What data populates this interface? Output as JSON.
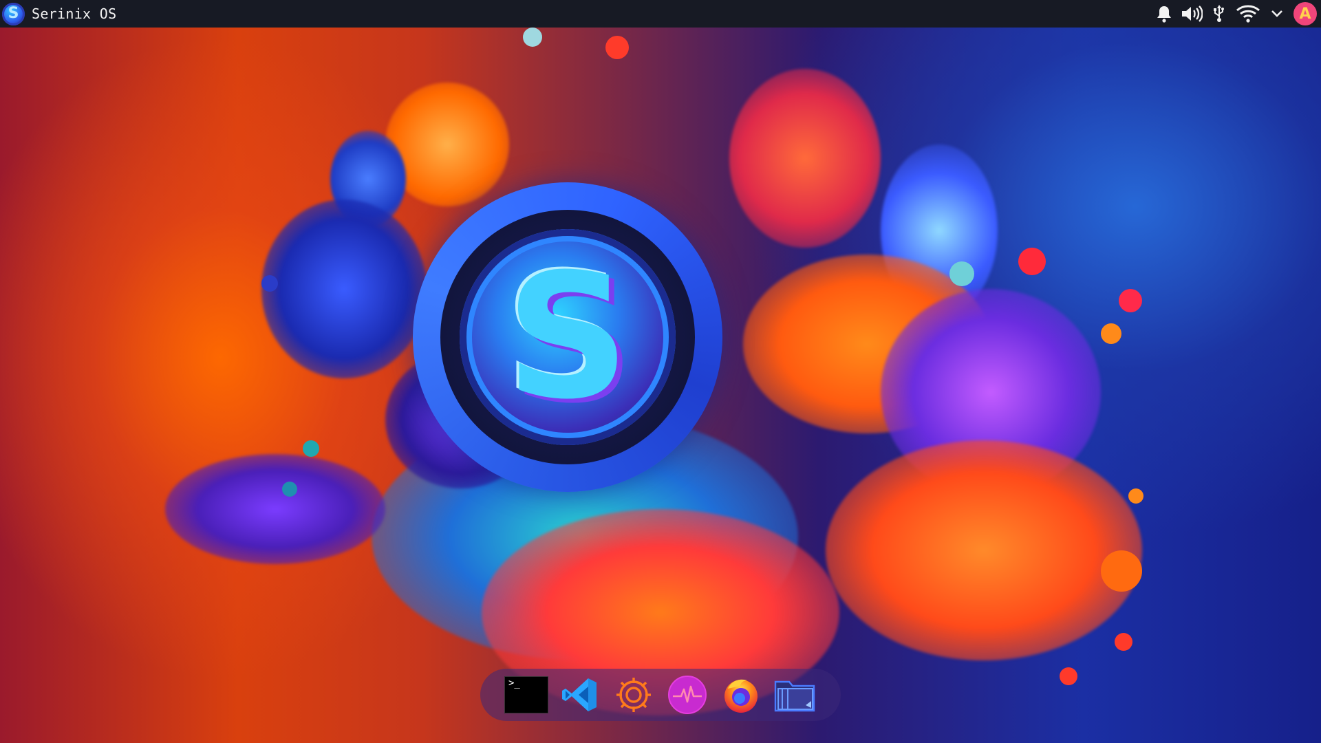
{
  "topbar": {
    "os_logo_letter": "S",
    "os_name": "Serinix OS",
    "tray": {
      "icons": [
        "bell-icon",
        "volume-icon",
        "usb-icon",
        "wifi-icon",
        "chevron-down-icon"
      ],
      "avatar_letter": "A"
    }
  },
  "wallpaper": {
    "center_logo_letter": "S"
  },
  "dock": {
    "apps": [
      {
        "name": "terminal",
        "icon": "terminal-icon",
        "glyph": ">_"
      },
      {
        "name": "vscode",
        "icon": "vscode-icon"
      },
      {
        "name": "settings",
        "icon": "gear-icon"
      },
      {
        "name": "system-monitor",
        "icon": "pulse-icon"
      },
      {
        "name": "firefox",
        "icon": "firefox-icon"
      },
      {
        "name": "file-manager",
        "icon": "folder-icon"
      }
    ]
  },
  "colors": {
    "topbar_bg": "#171a24",
    "avatar_bg": "#f0457a",
    "avatar_fg": "#ffd24d",
    "accent_blue": "#2a5be8",
    "accent_orange": "#ff6a00"
  }
}
